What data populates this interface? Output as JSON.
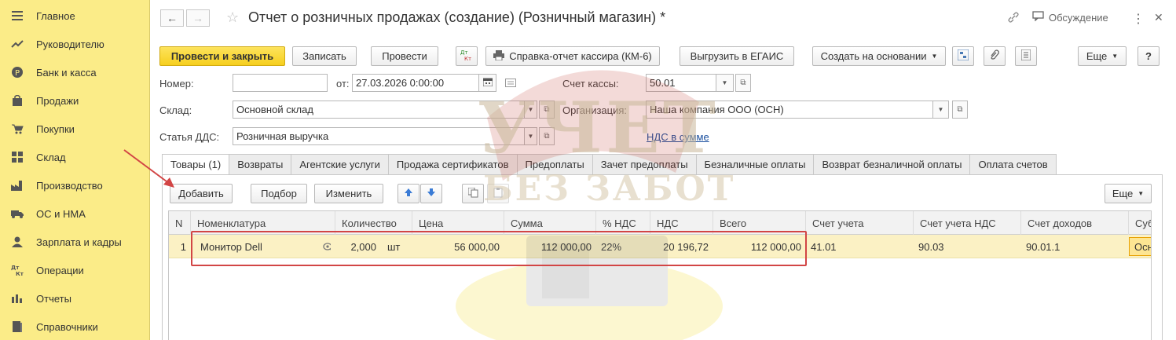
{
  "sidebar": {
    "items": [
      {
        "label": "Главное",
        "icon": "menu-icon"
      },
      {
        "label": "Руководителю",
        "icon": "trend-icon"
      },
      {
        "label": "Банк и касса",
        "icon": "ruble-icon"
      },
      {
        "label": "Продажи",
        "icon": "bag-icon"
      },
      {
        "label": "Покупки",
        "icon": "cart-icon"
      },
      {
        "label": "Склад",
        "icon": "warehouse-icon"
      },
      {
        "label": "Производство",
        "icon": "factory-icon"
      },
      {
        "label": "ОС и НМА",
        "icon": "truck-icon"
      },
      {
        "label": "Зарплата и кадры",
        "icon": "person-icon"
      },
      {
        "label": "Операции",
        "icon": "dt-kt-icon"
      },
      {
        "label": "Отчеты",
        "icon": "bar-chart-icon"
      },
      {
        "label": "Справочники",
        "icon": "book-icon"
      }
    ]
  },
  "header": {
    "title": "Отчет о розничных продажах (создание) (Розничный магазин) *",
    "discussion": "Обсуждение",
    "more_symbol": "⋮",
    "close_symbol": "✕"
  },
  "toolbar": {
    "post_close": "Провести и закрыть",
    "save": "Записать",
    "post": "Провести",
    "dtkt": "Дт Кт",
    "cashier_report": "Справка-отчет кассира (КМ-6)",
    "egais": "Выгрузить в ЕГАИС",
    "create_based": "Создать на основании",
    "more": "Еще",
    "help": "?"
  },
  "form": {
    "number_label": "Номер:",
    "number_value": "",
    "date_label": "от:",
    "date_value": "27.03.2026  0:00:00",
    "cash_account_label": "Счет кассы:",
    "cash_account_value": "50.01",
    "warehouse_label": "Склад:",
    "warehouse_value": "Основной склад",
    "org_label": "Организация:",
    "org_value": "Наша компания ООО (ОСН)",
    "dds_label": "Статья ДДС:",
    "dds_value": "Розничная выручка",
    "vat_link": "НДС в сумме"
  },
  "tabs": [
    "Товары (1)",
    "Возвраты",
    "Агентские услуги",
    "Продажа сертификатов",
    "Предоплаты",
    "Зачет предоплаты",
    "Безналичные оплаты",
    "Возврат безналичной оплаты",
    "Оплата счетов"
  ],
  "table_toolbar": {
    "add": "Добавить",
    "pick": "Подбор",
    "change": "Изменить",
    "more": "Еще"
  },
  "table": {
    "columns": [
      "N",
      "Номенклатура",
      "Количество",
      "Цена",
      "Сумма",
      "% НДС",
      "НДС",
      "Всего",
      "Счет учета",
      "Счет учета НДС",
      "Счет доходов",
      "Суб"
    ],
    "rows": [
      {
        "n": "1",
        "item": "Монитор Dell",
        "qty": "2,000",
        "unit": "шт",
        "price": "56 000,00",
        "sum": "112 000,00",
        "vat_rate": "22%",
        "vat": "20 196,72",
        "total": "112 000,00",
        "account": "41.01",
        "vat_account": "90.03",
        "income_account": "90.01.1",
        "sub": "Осн"
      }
    ]
  },
  "watermark": {
    "line1": "УЧЕТ",
    "line2": "БЕЗ ЗАБОТ"
  },
  "colors": {
    "sidebar_bg": "#fbec88",
    "primary_button": "#f6cf1e",
    "selected_row": "#fbf1c4",
    "annotation": "#d24545",
    "link": "#1a4f9e"
  }
}
